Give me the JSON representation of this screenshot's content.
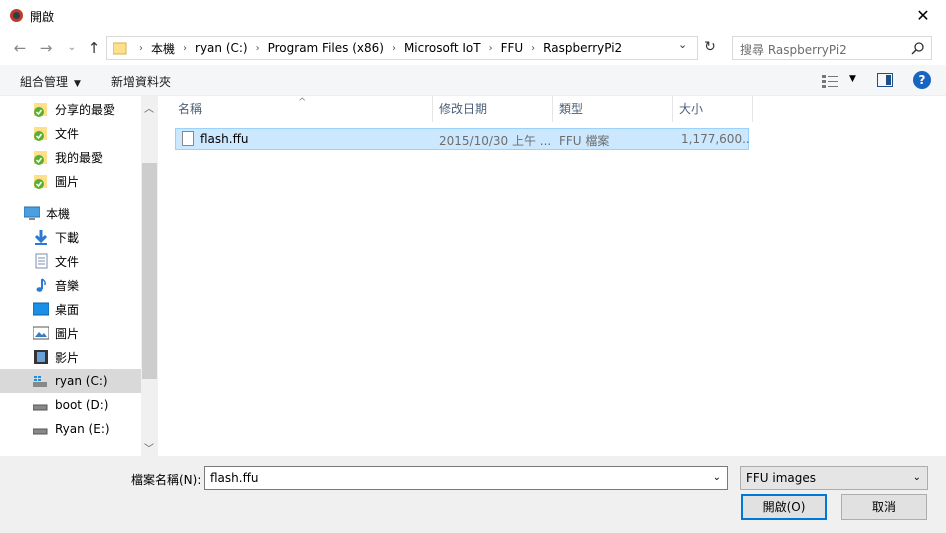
{
  "window": {
    "title": "開啟"
  },
  "address": {
    "crumbs": [
      "本機",
      "ryan (C:)",
      "Program Files (x86)",
      "Microsoft IoT",
      "FFU",
      "RaspberryPi2"
    ]
  },
  "search": {
    "placeholder": "搜尋 RaspberryPi2"
  },
  "toolbar": {
    "organize_label": "組合管理",
    "new_folder_label": "新增資料夾"
  },
  "sidebar": {
    "items": [
      {
        "label": "分享的最愛",
        "icon": "shared-favorites-icon"
      },
      {
        "label": "文件",
        "icon": "documents-icon"
      },
      {
        "label": "我的最愛",
        "icon": "favorites-icon"
      },
      {
        "label": "圖片",
        "icon": "pictures-icon"
      },
      {
        "label": "本機",
        "icon": "computer-icon"
      },
      {
        "label": "下載",
        "icon": "downloads-icon"
      },
      {
        "label": "文件",
        "icon": "documents-icon"
      },
      {
        "label": "音樂",
        "icon": "music-icon"
      },
      {
        "label": "桌面",
        "icon": "desktop-icon"
      },
      {
        "label": "圖片",
        "icon": "pictures-icon"
      },
      {
        "label": "影片",
        "icon": "videos-icon"
      },
      {
        "label": "ryan (C:)",
        "icon": "drive-c-icon"
      },
      {
        "label": "boot (D:)",
        "icon": "drive-icon"
      },
      {
        "label": "Ryan (E:)",
        "icon": "drive-icon"
      }
    ]
  },
  "columns": {
    "name": "名稱",
    "date": "修改日期",
    "type": "類型",
    "size": "大小"
  },
  "files": [
    {
      "name": "flash.ffu",
      "date": "2015/10/30 上午 ...",
      "type": "FFU 檔案",
      "size": "1,177,600..."
    }
  ],
  "footer": {
    "filename_label": "檔案名稱(N):",
    "filename_value": "flash.ffu",
    "filetype_value": "FFU images",
    "open_label": "開啟(O)",
    "cancel_label": "取消"
  },
  "colors": {
    "accent": "#0078d7",
    "selection": "#cce8ff",
    "help": "#1665c1"
  }
}
